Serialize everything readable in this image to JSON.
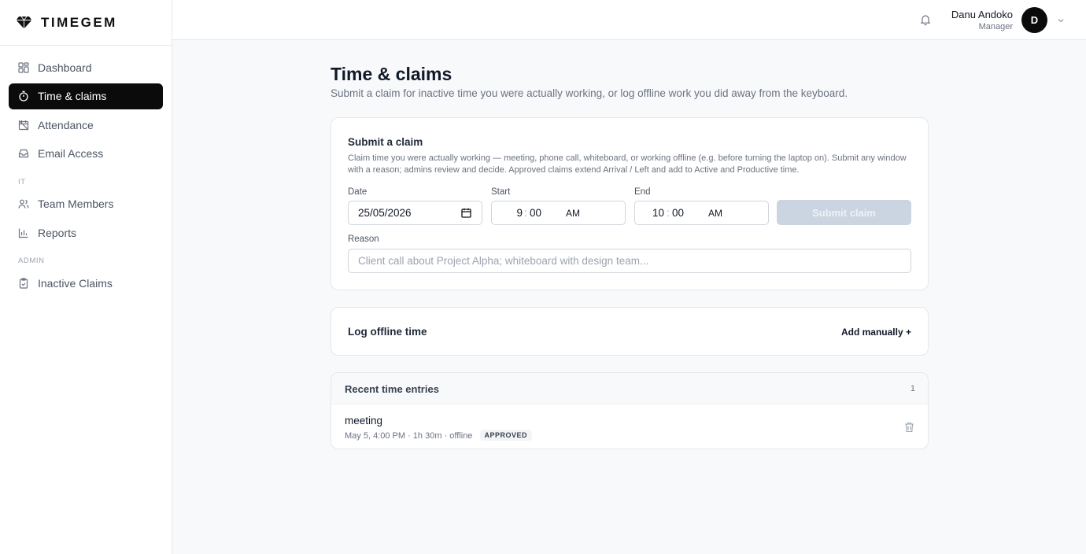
{
  "brand": {
    "name": "TIMEGEM",
    "icon": "diamond-icon"
  },
  "sidebar": {
    "items": [
      {
        "label": "Dashboard",
        "icon": "dashboard-icon",
        "active": false
      },
      {
        "label": "Time & claims",
        "icon": "stopwatch-icon",
        "active": true
      },
      {
        "label": "Attendance",
        "icon": "calendar-off-icon",
        "active": false
      },
      {
        "label": "Email Access",
        "icon": "inbox-icon",
        "active": false
      }
    ],
    "section_it": "IT",
    "it_items": [
      {
        "label": "Team Members",
        "icon": "users-icon"
      },
      {
        "label": "Reports",
        "icon": "bar-chart-icon"
      }
    ],
    "section_admin": "ADMIN",
    "admin_items": [
      {
        "label": "Inactive Claims",
        "icon": "clipboard-check-icon"
      }
    ]
  },
  "header": {
    "user_name": "Danu Andoko",
    "user_role": "Manager",
    "avatar_initial": "D",
    "bell_icon": "bell-icon",
    "menu_icon": "chevron-down-icon"
  },
  "page": {
    "title": "Time & claims",
    "subtitle": "Submit a claim for inactive time you were actually working, or log offline work you did away from the keyboard."
  },
  "claim_form": {
    "title": "Submit a claim",
    "description": "Claim time you were actually working — meeting, phone call, whiteboard, or working offline (e.g. before turning the laptop on). Submit any window with a reason; admins review and decide. Approved claims extend Arrival / Left and add to Active and Productive time.",
    "date_label": "Date",
    "date_value": "25/05/2026",
    "start_label": "Start",
    "start_hour": "9",
    "start_minute": "00",
    "start_ampm": "AM",
    "end_label": "End",
    "end_hour": "10",
    "end_minute": "00",
    "end_ampm": "AM",
    "time_separator": ":",
    "submit_label": "Submit claim",
    "reason_label": "Reason",
    "reason_placeholder": "Client call about Project Alpha; whiteboard with design team...",
    "reason_value": ""
  },
  "offline": {
    "title": "Log offline time",
    "add_label": "Add manually +"
  },
  "recent": {
    "title": "Recent time entries",
    "count": "1",
    "entries": [
      {
        "title": "meeting",
        "meta": "May 5, 4:00 PM · 1h 30m · offline",
        "status": "APPROVED"
      }
    ]
  },
  "colors": {
    "accent": "#0b0b0c",
    "disabled_button": "#cbd5e1",
    "page_bg": "#f8f9fb"
  }
}
